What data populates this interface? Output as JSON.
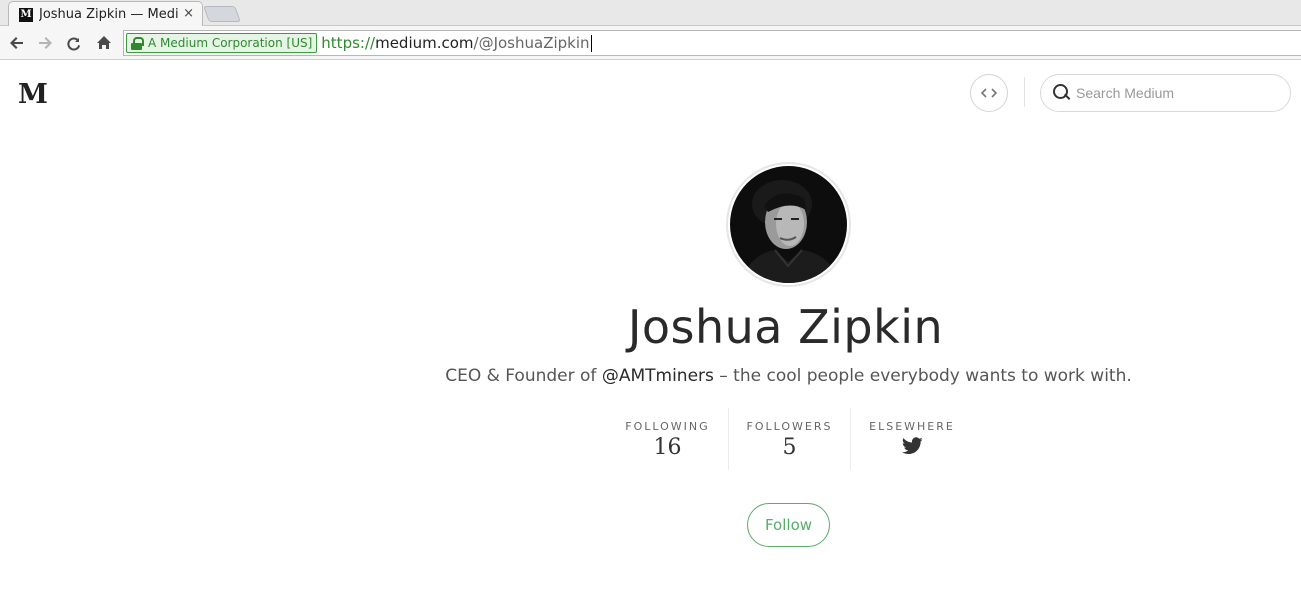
{
  "browser": {
    "tab_title": "Joshua Zipkin — Medium",
    "tab_favicon": "M",
    "tab_close": "×",
    "ev_label": "A Medium Corporation [US]",
    "url_scheme": "https://",
    "url_host": "medium.com",
    "url_path": "/@JoshuaZipkin"
  },
  "header": {
    "logo": "M",
    "embed_icon": "‹›",
    "search_placeholder": "Search Medium"
  },
  "profile": {
    "name": "Joshua Zipkin",
    "bio_prefix": "CEO & Founder of ",
    "bio_link": "@AMTminers",
    "bio_suffix": " – the cool people everybody wants to work with.",
    "stats": [
      {
        "label": "FOLLOWING",
        "value": "16"
      },
      {
        "label": "FOLLOWERS",
        "value": "5"
      },
      {
        "label": "ELSEWHERE",
        "icon": "twitter-icon"
      }
    ],
    "follow_label": "Follow"
  },
  "colors": {
    "accent_green": "#57ad68",
    "ev_green": "#2f8a2f"
  }
}
